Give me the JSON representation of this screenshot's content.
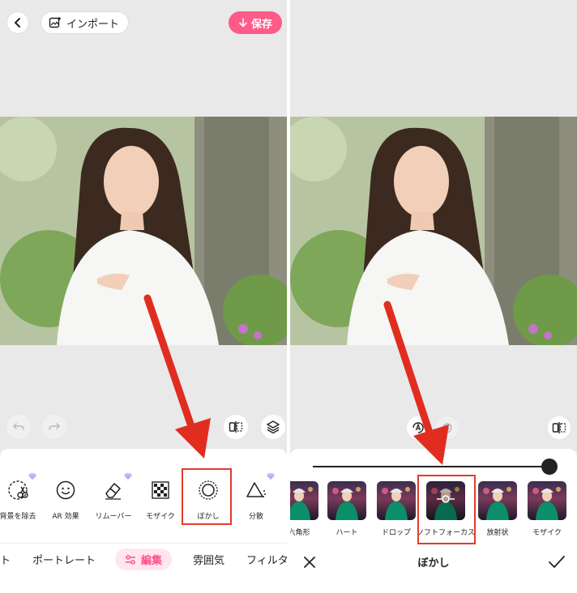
{
  "left": {
    "import_label": "インポート",
    "save_label": "保存",
    "tools": [
      {
        "label": "背景を除去",
        "icon": "scissors-icon",
        "premium": true
      },
      {
        "label": "AR 効果",
        "icon": "smiley-icon",
        "premium": false
      },
      {
        "label": "リムーバー",
        "icon": "eraser-icon",
        "premium": true
      },
      {
        "label": "モザイク",
        "icon": "mosaic-icon",
        "premium": false
      },
      {
        "label": "ぼかし",
        "icon": "blur-circle-icon",
        "premium": false
      },
      {
        "label": "分散",
        "icon": "triangle-icon",
        "premium": true
      }
    ],
    "categories": [
      {
        "label": "ト"
      },
      {
        "label": "ポートレート"
      },
      {
        "label": "編集"
      },
      {
        "label": "雰囲気"
      },
      {
        "label": "フィルタ-"
      }
    ]
  },
  "right": {
    "effects": [
      {
        "label": "六角形"
      },
      {
        "label": "ハート"
      },
      {
        "label": "ドロップ"
      },
      {
        "label": "ソフトフォーカス"
      },
      {
        "label": "放射状"
      },
      {
        "label": "モザイク"
      }
    ],
    "title": "ぼかし",
    "slider_value": 1.0
  },
  "colors": {
    "accent": "#ff5b88",
    "highlight": "#e53a2c",
    "arrow": "#e02d1f"
  }
}
